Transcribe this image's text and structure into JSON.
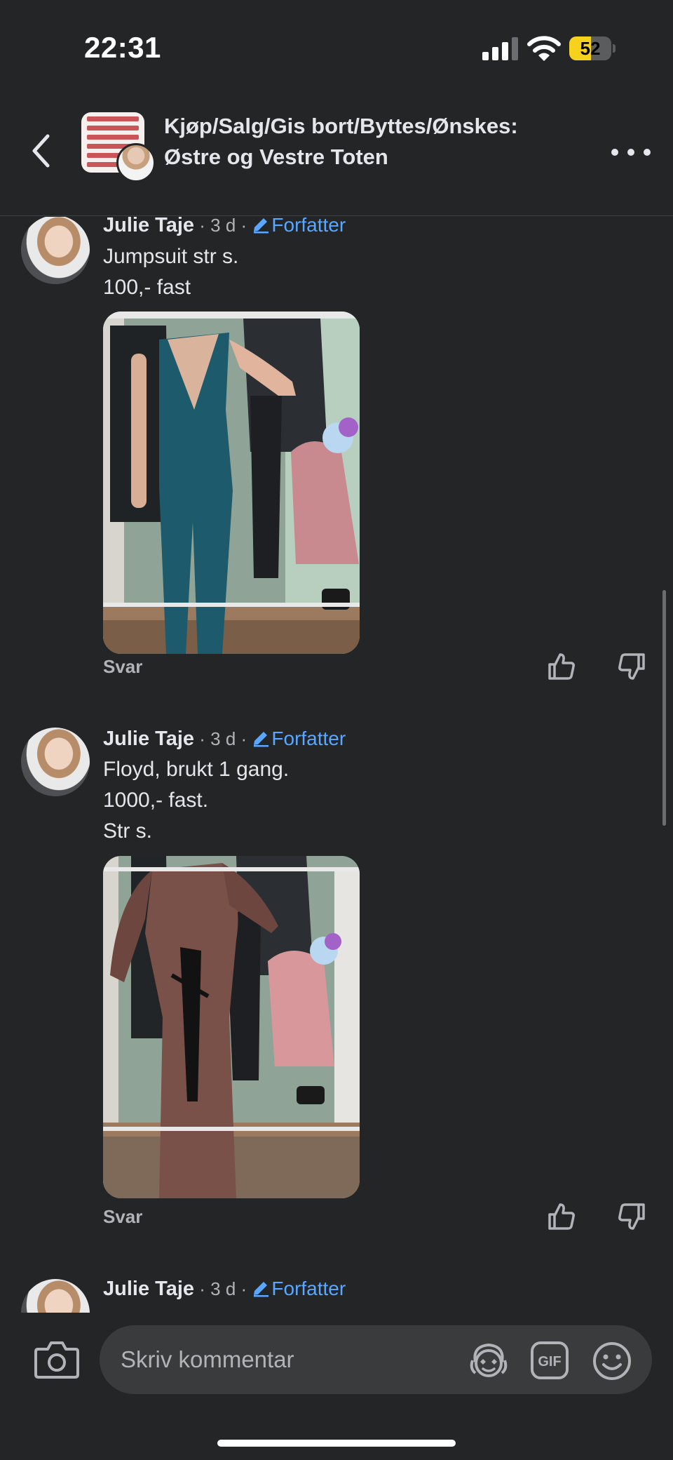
{
  "status_bar": {
    "time": "22:31",
    "battery_level": "52",
    "battery_fraction": 0.52
  },
  "header": {
    "group_title_line1": "Kjøp/Salg/Gis bort/Byttes/Ønskes:",
    "group_title_line2": "Østre og Vestre Toten",
    "back_icon": "chevron-left-icon",
    "more_icon": "more-horizontal-icon"
  },
  "comments": [
    {
      "author": "Julie Taje",
      "meta": " · 3 d · ",
      "badge": "Forfatter",
      "lines": [
        "Jumpsuit str s.",
        "100,- fast"
      ],
      "photo_description_icon": "photo-jumpsuit",
      "reply_label": "Svar"
    },
    {
      "author": "Julie Taje",
      "meta": " · 3 d · ",
      "badge": "Forfatter",
      "lines": [
        "Floyd, brukt 1 gang.",
        "1000,- fast.",
        "Str s."
      ],
      "photo_description_icon": "photo-sequin-dress",
      "reply_label": "Svar"
    },
    {
      "author": "Julie Taje",
      "meta": " · 3 d · ",
      "badge": "Forfatter"
    }
  ],
  "composer": {
    "placeholder": "Skriv kommentar",
    "gif_label": "GIF"
  },
  "colors": {
    "background": "#242526",
    "badge_blue": "#5aa7ff",
    "battery_yellow": "#f7d21c"
  }
}
